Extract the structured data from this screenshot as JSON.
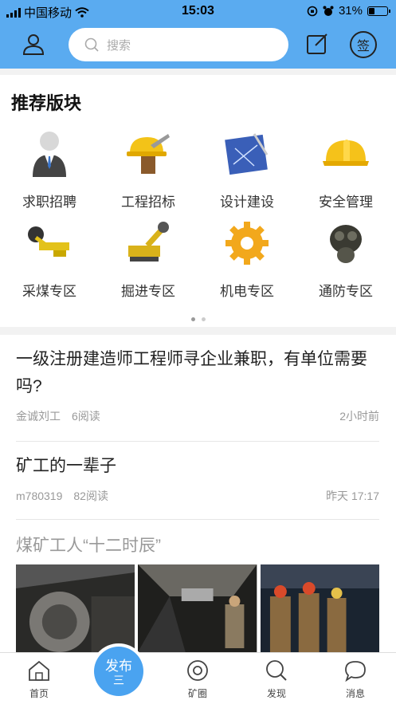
{
  "status_bar": {
    "carrier": "中国移动",
    "time": "15:03",
    "battery": "31%",
    "battery_level": 0.31
  },
  "header": {
    "search_placeholder": "搜索",
    "sign_label": "签"
  },
  "recommend": {
    "title": "推荐版块",
    "items": [
      {
        "label": "求职招聘",
        "icon": "job-person-icon"
      },
      {
        "label": "工程招标",
        "icon": "hardhat-trowel-icon"
      },
      {
        "label": "设计建设",
        "icon": "blueprint-icon"
      },
      {
        "label": "安全管理",
        "icon": "safety-helmet-icon"
      },
      {
        "label": "采煤专区",
        "icon": "coal-shearer-icon"
      },
      {
        "label": "掘进专区",
        "icon": "roadheader-icon"
      },
      {
        "label": "机电专区",
        "icon": "gear-icon"
      },
      {
        "label": "通防专区",
        "icon": "gas-mask-icon"
      }
    ]
  },
  "feed": {
    "posts": [
      {
        "title": "一级注册建造师工程师寻企业兼职，有单位需要吗?",
        "author": "金诚刘工",
        "reads": "6阅读",
        "time": "2小时前"
      },
      {
        "title": "矿工的一辈子",
        "author": "m780319",
        "reads": "82阅读",
        "time": "昨天 17:17"
      }
    ],
    "photo_post_title": "煤矿工人“十二时辰”"
  },
  "tabbar": {
    "home": "首页",
    "publish": "发布",
    "publish_glyph": "三",
    "circle": "矿圈",
    "discover": "发现",
    "messages": "消息"
  },
  "colors": {
    "header": "#5aabf0",
    "publish": "#4aa3f0"
  }
}
